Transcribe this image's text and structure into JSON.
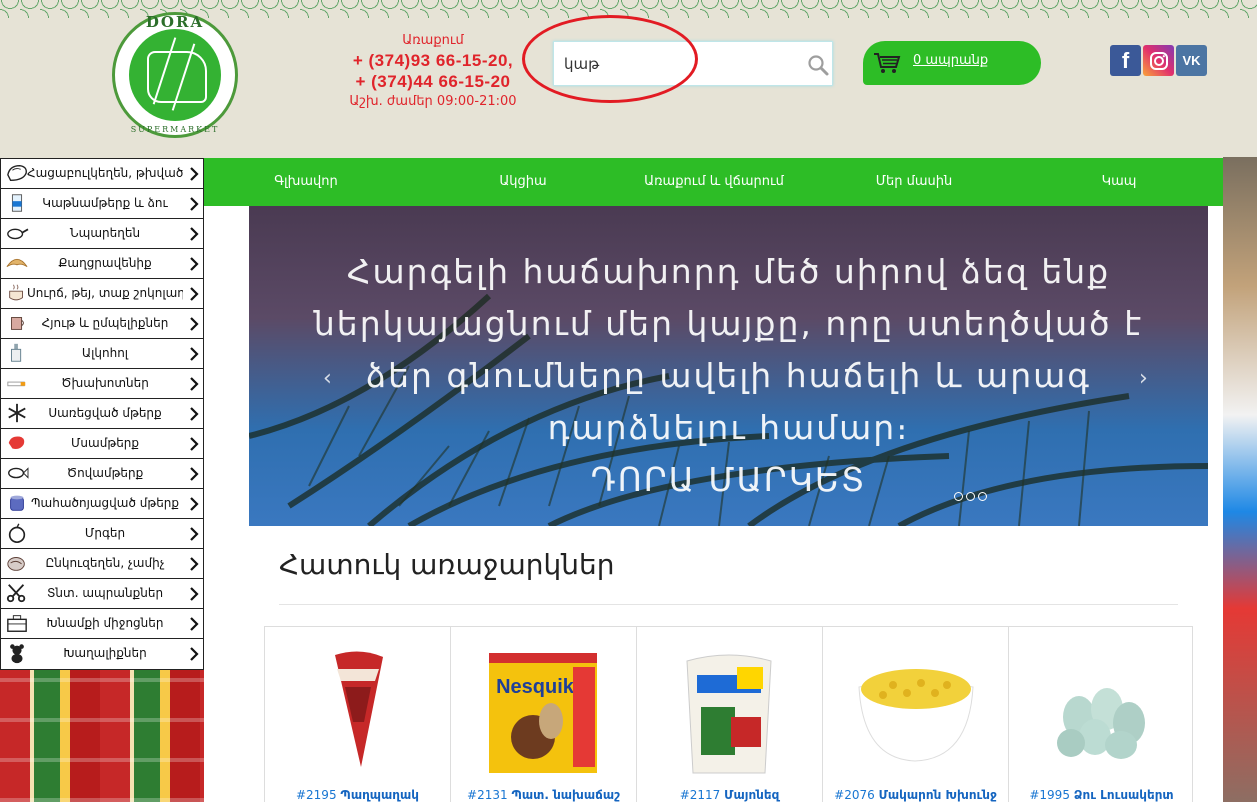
{
  "header": {
    "logo": {
      "brand": "DORA",
      "sub": "SUPERMARKET"
    },
    "contacts": {
      "label": "Առաքում",
      "phone1": "+ (374)93 66-15-20,",
      "phone2": "+ (374)44 66-15-20",
      "hours": "Աշխ. ժամեր 09:00-21:00"
    },
    "search": {
      "value": "կաթ",
      "placeholder": ""
    },
    "cart": {
      "label": "0 ապրանք"
    },
    "social": [
      "facebook-icon",
      "instagram-icon",
      "vk-icon"
    ]
  },
  "sidebar": {
    "items": [
      {
        "label": "Հացաբուլկեղեն, թխվածք",
        "icon": "bread-icon"
      },
      {
        "label": "Կաթնամթերք և ձու",
        "icon": "milk-icon"
      },
      {
        "label": "Նպարեղեն",
        "icon": "pan-icon"
      },
      {
        "label": "Քաղցրավենիք",
        "icon": "croissant-icon"
      },
      {
        "label": "Սուրճ, թեյ, տաք շոկոլադ",
        "icon": "coffee-icon"
      },
      {
        "label": "Հյութ և ըմպելիքներ",
        "icon": "cup-icon"
      },
      {
        "label": "Ալկոհոլ",
        "icon": "bottle-icon"
      },
      {
        "label": "Ծխախոտներ",
        "icon": "cigarette-icon"
      },
      {
        "label": "Սառեցված մթերք",
        "icon": "snowflake-icon"
      },
      {
        "label": "Մսամթերք",
        "icon": "meat-icon"
      },
      {
        "label": "Ծովամթերք",
        "icon": "fish-icon"
      },
      {
        "label": "Պահածոյացված մթերք",
        "icon": "can-icon"
      },
      {
        "label": "Մրգեր",
        "icon": "apple-icon"
      },
      {
        "label": "Ընկուզեղեն, չամիչ",
        "icon": "nuts-icon"
      },
      {
        "label": "Տնտ. ապրանքներ",
        "icon": "scissors-icon"
      },
      {
        "label": "Խնամքի միջոցներ",
        "icon": "kit-icon"
      },
      {
        "label": "Խաղալիքներ",
        "icon": "teddy-icon"
      }
    ]
  },
  "nav": {
    "items": [
      "Գլխավոր",
      "Ակցիա",
      "Առաքում և վճարում",
      "Մեր մասին",
      "Կապ"
    ]
  },
  "banner": {
    "lines": [
      "Հարգելի հաճախորդ մեծ սիրով ձեզ ենք",
      "ներկայացնում մեր կայքը, որը ստեղծված է",
      "ձեր գնումները ավելի հաճելի և արագ",
      "դարձնելու համար։",
      "ԴՈՐԱ ՄԱՐԿԵՏ"
    ]
  },
  "specials": {
    "title": "Հատուկ առաջարկներ",
    "products": [
      {
        "id": "#2195",
        "name": "Պաղպաղակ"
      },
      {
        "id": "#2131",
        "name": "Պատ. նախաճաշ"
      },
      {
        "id": "#2117",
        "name": "Մայոնեզ"
      },
      {
        "id": "#2076",
        "name": "Մակարոն Խխունջ"
      },
      {
        "id": "#1995",
        "name": "Ձու Լուսակերտ"
      }
    ]
  },
  "colors": {
    "green": "#2dbd26",
    "red": "#e0242b",
    "link": "#1976d2"
  }
}
